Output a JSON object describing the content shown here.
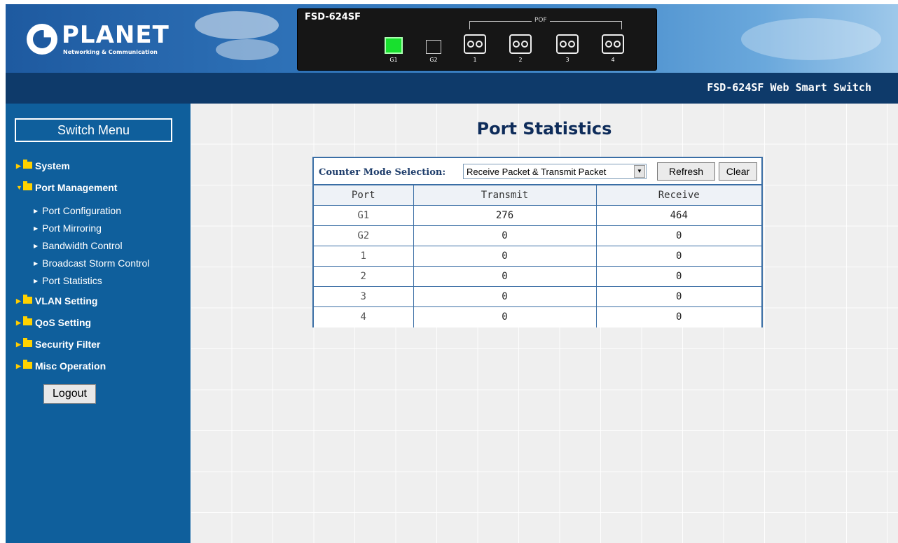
{
  "header": {
    "logo_text": "PLANET",
    "logo_tagline": "Networking & Communication",
    "device_model": "FSD-624SF",
    "pof_label": "POF",
    "ports": [
      {
        "label": "G1",
        "state": "active"
      },
      {
        "label": "G2",
        "state": "inactive"
      },
      {
        "label": "1",
        "state": "fiber"
      },
      {
        "label": "2",
        "state": "fiber"
      },
      {
        "label": "3",
        "state": "fiber"
      },
      {
        "label": "4",
        "state": "fiber"
      }
    ]
  },
  "titlebar": {
    "title": "FSD-624SF Web Smart Switch"
  },
  "sidebar": {
    "menu_title": "Switch Menu",
    "items": [
      {
        "label": "System"
      },
      {
        "label": "Port Management"
      },
      {
        "label": "VLAN Setting"
      },
      {
        "label": "QoS Setting"
      },
      {
        "label": "Security Filter"
      },
      {
        "label": "Misc Operation"
      }
    ],
    "sub_items": [
      {
        "label": "Port Configuration"
      },
      {
        "label": "Port Mirroring"
      },
      {
        "label": "Bandwidth Control"
      },
      {
        "label": "Broadcast Storm Control"
      },
      {
        "label": "Port Statistics"
      }
    ],
    "logout_label": "Logout"
  },
  "main": {
    "page_title": "Port Statistics",
    "counter_mode_label": "Counter Mode Selection:",
    "counter_mode_value": "Receive Packet & Transmit Packet",
    "refresh_label": "Refresh",
    "clear_label": "Clear",
    "table": {
      "headers": [
        "Port",
        "Transmit",
        "Receive"
      ],
      "rows": [
        {
          "port": "G1",
          "transmit": "276",
          "receive": "464"
        },
        {
          "port": "G2",
          "transmit": "0",
          "receive": "0"
        },
        {
          "port": "1",
          "transmit": "0",
          "receive": "0"
        },
        {
          "port": "2",
          "transmit": "0",
          "receive": "0"
        },
        {
          "port": "3",
          "transmit": "0",
          "receive": "0"
        },
        {
          "port": "4",
          "transmit": "0",
          "receive": "0"
        }
      ]
    }
  },
  "colors": {
    "header_blue": "#1e5aa0",
    "titlebar_navy": "#0e3a6a",
    "sidebar_blue": "#0f5f9c",
    "folder_yellow": "#ffd200",
    "port_active_green": "#18e02e",
    "table_border": "#3a6ea5"
  }
}
